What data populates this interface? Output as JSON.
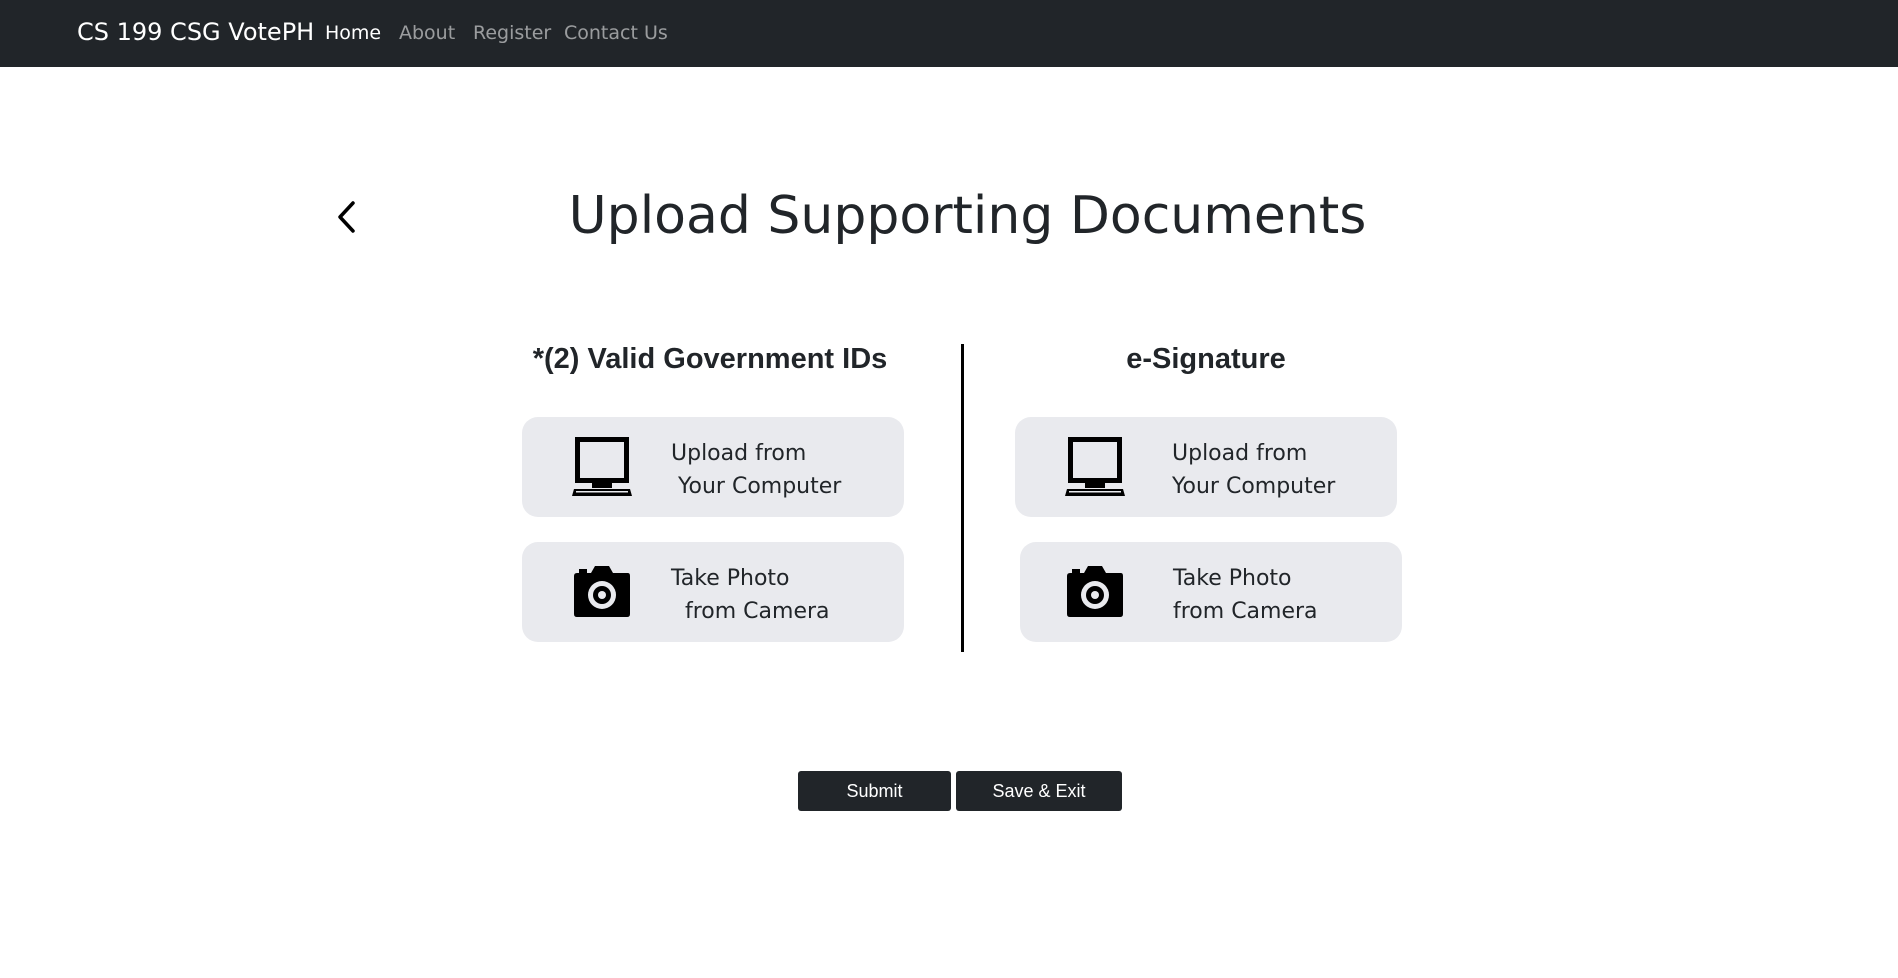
{
  "navbar": {
    "brand": "CS 199 CSG VotePH",
    "links": [
      {
        "label": "Home",
        "active": true
      },
      {
        "label": "About",
        "active": false
      },
      {
        "label": "Register",
        "active": false
      },
      {
        "label": "Contact Us",
        "active": false
      }
    ]
  },
  "page": {
    "back_icon": "chevron-left-icon",
    "title": "Upload Supporting Documents"
  },
  "sections": [
    {
      "title": "*(2) Valid Government IDs",
      "options": [
        {
          "icon": "computer-icon",
          "label": "Upload from\n Your Computer"
        },
        {
          "icon": "camera-icon",
          "label": "Take Photo\n  from Camera"
        }
      ]
    },
    {
      "title": "e-Signature",
      "options": [
        {
          "icon": "computer-icon",
          "label": "Upload from\nYour Computer"
        },
        {
          "icon": "camera-icon",
          "label": "Take Photo\nfrom Camera"
        }
      ]
    }
  ],
  "actions": {
    "submit_label": "Submit",
    "save_exit_label": "Save & Exit"
  },
  "colors": {
    "navbar_bg": "#212529",
    "card_bg": "#e9eaee",
    "button_bg": "#212529"
  }
}
